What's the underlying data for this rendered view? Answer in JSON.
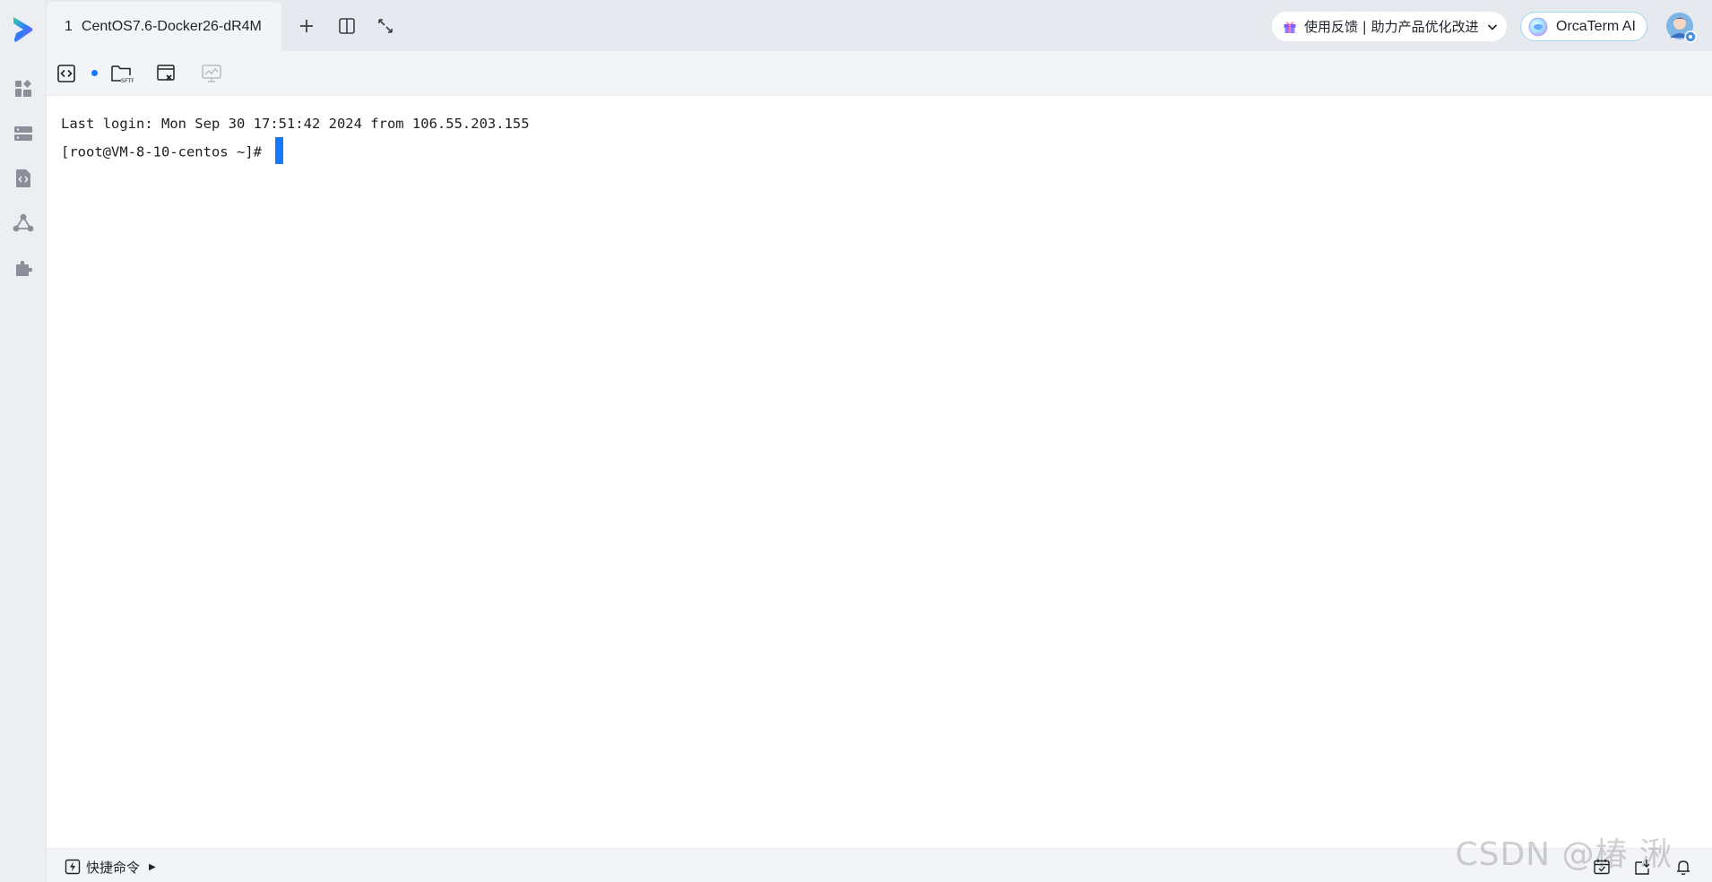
{
  "sidebar": {
    "logo": "app-logo",
    "items": [
      {
        "icon": "dashboard-icon"
      },
      {
        "icon": "server-list-icon"
      },
      {
        "icon": "code-file-icon"
      },
      {
        "icon": "network-nodes-icon"
      },
      {
        "icon": "plugin-icon"
      }
    ]
  },
  "tabbar": {
    "tab": {
      "number": "1",
      "label": "CentOS7.6-Docker26-dR4M"
    },
    "actions": [
      "add-tab-icon",
      "split-view-icon",
      "expand-icon"
    ],
    "feedback": {
      "label": "使用反馈 | 助力产品优化改进"
    },
    "ai": {
      "label": "OrcaTerm AI"
    }
  },
  "toolbar": {
    "tools": [
      "terminal-code-icon",
      "sftp-folder-icon",
      "file-edit-icon",
      "monitor-chart-icon"
    ],
    "sftp_label": "SFTP",
    "status_color": "#1677ff"
  },
  "terminal": {
    "lines": [
      "Last login: Mon Sep 30 17:51:42 2024 from 106.55.203.155",
      "[root@VM-8-10-centos ~]# "
    ],
    "cursor_color": "#1677ff"
  },
  "bottombar": {
    "quick_label": "快捷命令",
    "watermark": "CSDN @椿  湫",
    "icons": [
      "calendar-check-icon",
      "download-box-icon",
      "bell-icon"
    ]
  }
}
